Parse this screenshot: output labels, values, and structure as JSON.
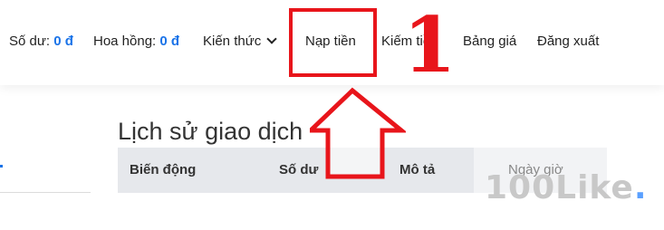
{
  "nav": {
    "balance_label": "Số dư:",
    "balance_value": "0 đ",
    "commission_label": "Hoa hồng:",
    "commission_value": "0 đ",
    "knowledge": "Kiến thức",
    "topup": "Nạp tiền",
    "earn": "Kiếm tiền",
    "pricing": "Bảng giá",
    "logout": "Đăng xuất"
  },
  "page": {
    "title": "Lịch sử giao dịch"
  },
  "table": {
    "headers": [
      "Biến động",
      "Số dư",
      "Mô tả",
      "Ngày giờ"
    ]
  },
  "annotation": {
    "step_number": "1",
    "color": "#e8151b"
  },
  "watermark": {
    "text": "100Like",
    "dot": "."
  },
  "colors": {
    "accent": "#1a73e8",
    "table_header_bg": "#e6e8ec"
  }
}
